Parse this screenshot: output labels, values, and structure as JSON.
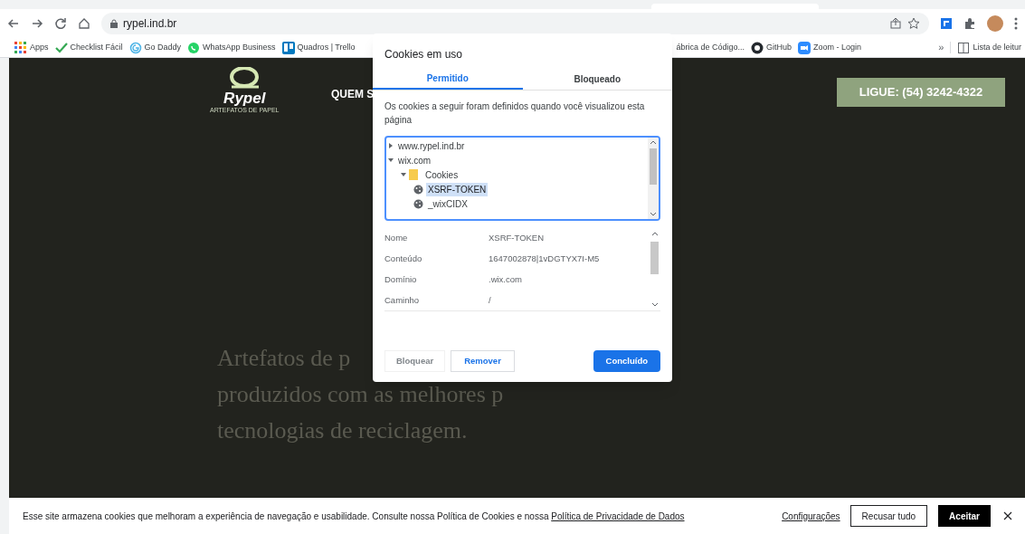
{
  "browser": {
    "url": "rypel.ind.br",
    "bookmarks": [
      {
        "label": "Apps",
        "kind": "apps"
      },
      {
        "label": "Checklist Fácil",
        "kind": "check"
      },
      {
        "label": "Go Daddy",
        "kind": "swirl"
      },
      {
        "label": "WhatsApp Business",
        "kind": "chat"
      },
      {
        "label": "Quadros | Trello",
        "kind": "board"
      },
      {
        "label": "ábrica de Código...",
        "kind": "none"
      },
      {
        "label": "GitHub",
        "kind": "octocat"
      },
      {
        "label": "Zoom - Login",
        "kind": "camera"
      }
    ],
    "more": "»",
    "reading_list": "Lista de leitur"
  },
  "site": {
    "logo_name": "Rypel",
    "logo_tagline": "ARTEFATOS DE PAPEL",
    "nav": [
      "QUEM S"
    ],
    "cta": "LIGUE: (54) 3242-4322",
    "hero_lines": [
      "Artefatos de p",
      "produzidos com as melhores p",
      "tecnologias de reciclagem."
    ]
  },
  "dialog": {
    "title": "Cookies em uso",
    "tabs": [
      {
        "label": "Permitido",
        "selected": true
      },
      {
        "label": "Bloqueado",
        "selected": false
      }
    ],
    "description": "Os cookies a seguir foram definidos quando você visualizou esta página",
    "tree": [
      {
        "label": "www.rypel.ind.br",
        "kind": "domain",
        "expanded": false,
        "selected": false
      },
      {
        "label": "wix.com",
        "kind": "domain",
        "expanded": true,
        "selected": false,
        "children": [
          {
            "label": "Cookies",
            "kind": "folder",
            "expanded": true,
            "selected": false,
            "children": [
              {
                "label": "XSRF-TOKEN",
                "kind": "cookie",
                "selected": true
              },
              {
                "label": "_wixCIDX",
                "kind": "cookie",
                "selected": false
              }
            ]
          }
        ]
      }
    ],
    "details": [
      {
        "label": "Nome",
        "value": "XSRF-TOKEN"
      },
      {
        "label": "Conteúdo",
        "value": "1647002878|1vDGTYX7I-M5"
      },
      {
        "label": "Domínio",
        "value": ".wix.com"
      },
      {
        "label": "Caminho",
        "value": "/"
      }
    ],
    "buttons": [
      {
        "label": "Bloquear",
        "kind": "plain"
      },
      {
        "label": "Remover",
        "kind": "link"
      },
      {
        "label": "Concluído",
        "kind": "primary"
      }
    ]
  },
  "banner": {
    "text": "Esse site armazena cookies que melhoram a experiência de navegação e usabilidade. Consulte nossa Política de Cookies e nossa",
    "link": "Política de Privacidade de Dados",
    "settings": "Configurações",
    "reject": "Recusar tudo",
    "accept": "Aceitar"
  }
}
